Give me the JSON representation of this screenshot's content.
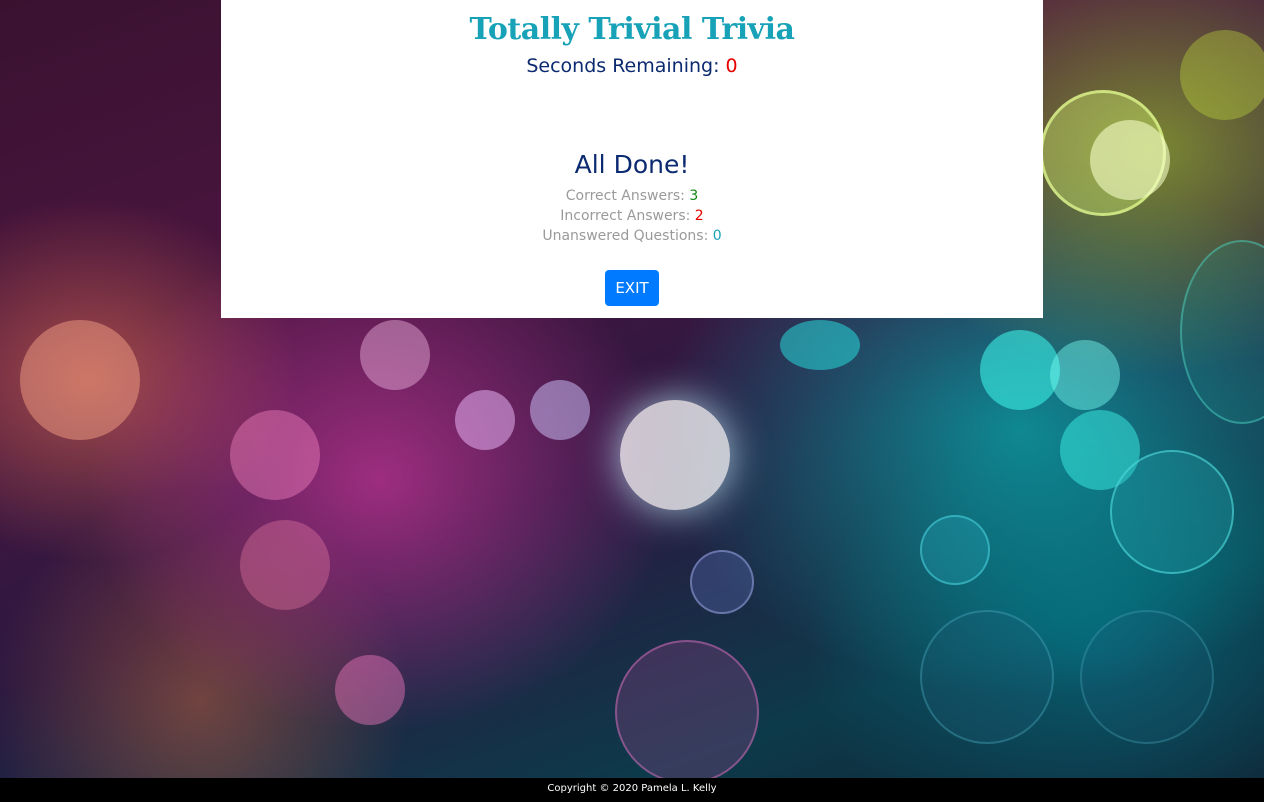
{
  "header": {
    "title": "Totally Trivial Trivia",
    "timer_label": "Seconds Remaining:",
    "timer_value": "0"
  },
  "results": {
    "heading": "All Done!",
    "correct_label": "Correct Answers:",
    "correct_value": "3",
    "incorrect_label": "Incorrect Answers:",
    "incorrect_value": "2",
    "unanswered_label": "Unanswered Questions:",
    "unanswered_value": "0",
    "exit_label": "EXIT"
  },
  "footer": {
    "copyright": "Copyright © 2020 Pamela L. Kelly"
  },
  "colors": {
    "title": "#17a2b8",
    "heading": "#0b2a6f",
    "correct": "#118811",
    "incorrect": "#e60000",
    "unanswered": "#17a2b8",
    "button": "#007bff"
  }
}
